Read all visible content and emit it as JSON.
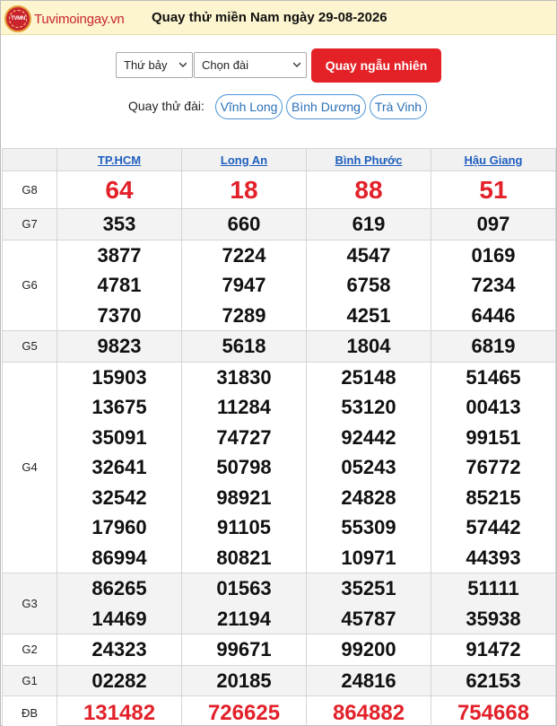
{
  "header": {
    "logo_text": "Tuvimoingay.vn",
    "logo_badge": "TVMN",
    "title": "Quay thử miền Nam ngày 29-08-2026"
  },
  "controls": {
    "day_select": "Thứ bảy",
    "station_select": "Chọn đài",
    "random_button": "Quay ngẫu nhiên",
    "quick_label": "Quay thử đài:",
    "quick_links": [
      "Vĩnh Long",
      "Bình Dương",
      "Trà Vinh"
    ]
  },
  "results": {
    "provinces": [
      "TP.HCM",
      "Long An",
      "Bình Phước",
      "Hậu Giang"
    ],
    "prizes": [
      {
        "label": "G8",
        "values": [
          [
            "64"
          ],
          [
            "18"
          ],
          [
            "88"
          ],
          [
            "51"
          ]
        ]
      },
      {
        "label": "G7",
        "values": [
          [
            "353"
          ],
          [
            "660"
          ],
          [
            "619"
          ],
          [
            "097"
          ]
        ]
      },
      {
        "label": "G6",
        "values": [
          [
            "3877",
            "4781",
            "7370"
          ],
          [
            "7224",
            "7947",
            "7289"
          ],
          [
            "4547",
            "6758",
            "4251"
          ],
          [
            "0169",
            "7234",
            "6446"
          ]
        ]
      },
      {
        "label": "G5",
        "values": [
          [
            "9823"
          ],
          [
            "5618"
          ],
          [
            "1804"
          ],
          [
            "6819"
          ]
        ]
      },
      {
        "label": "G4",
        "values": [
          [
            "15903",
            "13675",
            "35091",
            "32641",
            "32542",
            "17960",
            "86994"
          ],
          [
            "31830",
            "11284",
            "74727",
            "50798",
            "98921",
            "91105",
            "80821"
          ],
          [
            "25148",
            "53120",
            "92442",
            "05243",
            "24828",
            "55309",
            "10971"
          ],
          [
            "51465",
            "00413",
            "99151",
            "76772",
            "85215",
            "57442",
            "44393"
          ]
        ]
      },
      {
        "label": "G3",
        "values": [
          [
            "86265",
            "14469"
          ],
          [
            "01563",
            "21194"
          ],
          [
            "35251",
            "45787"
          ],
          [
            "51111",
            "35938"
          ]
        ]
      },
      {
        "label": "G2",
        "values": [
          [
            "24323"
          ],
          [
            "99671"
          ],
          [
            "99200"
          ],
          [
            "91472"
          ]
        ]
      },
      {
        "label": "G1",
        "values": [
          [
            "02282"
          ],
          [
            "20185"
          ],
          [
            "24816"
          ],
          [
            "62153"
          ]
        ]
      },
      {
        "label": "ĐB",
        "values": [
          [
            "131482"
          ],
          [
            "726625"
          ],
          [
            "864882"
          ],
          [
            "754668"
          ]
        ]
      }
    ]
  },
  "colors": {
    "header_bg": "#fdf5cf",
    "accent_red": "#e42126",
    "link_blue": "#1f5fbf",
    "row_shade": "#f3f3f3"
  }
}
